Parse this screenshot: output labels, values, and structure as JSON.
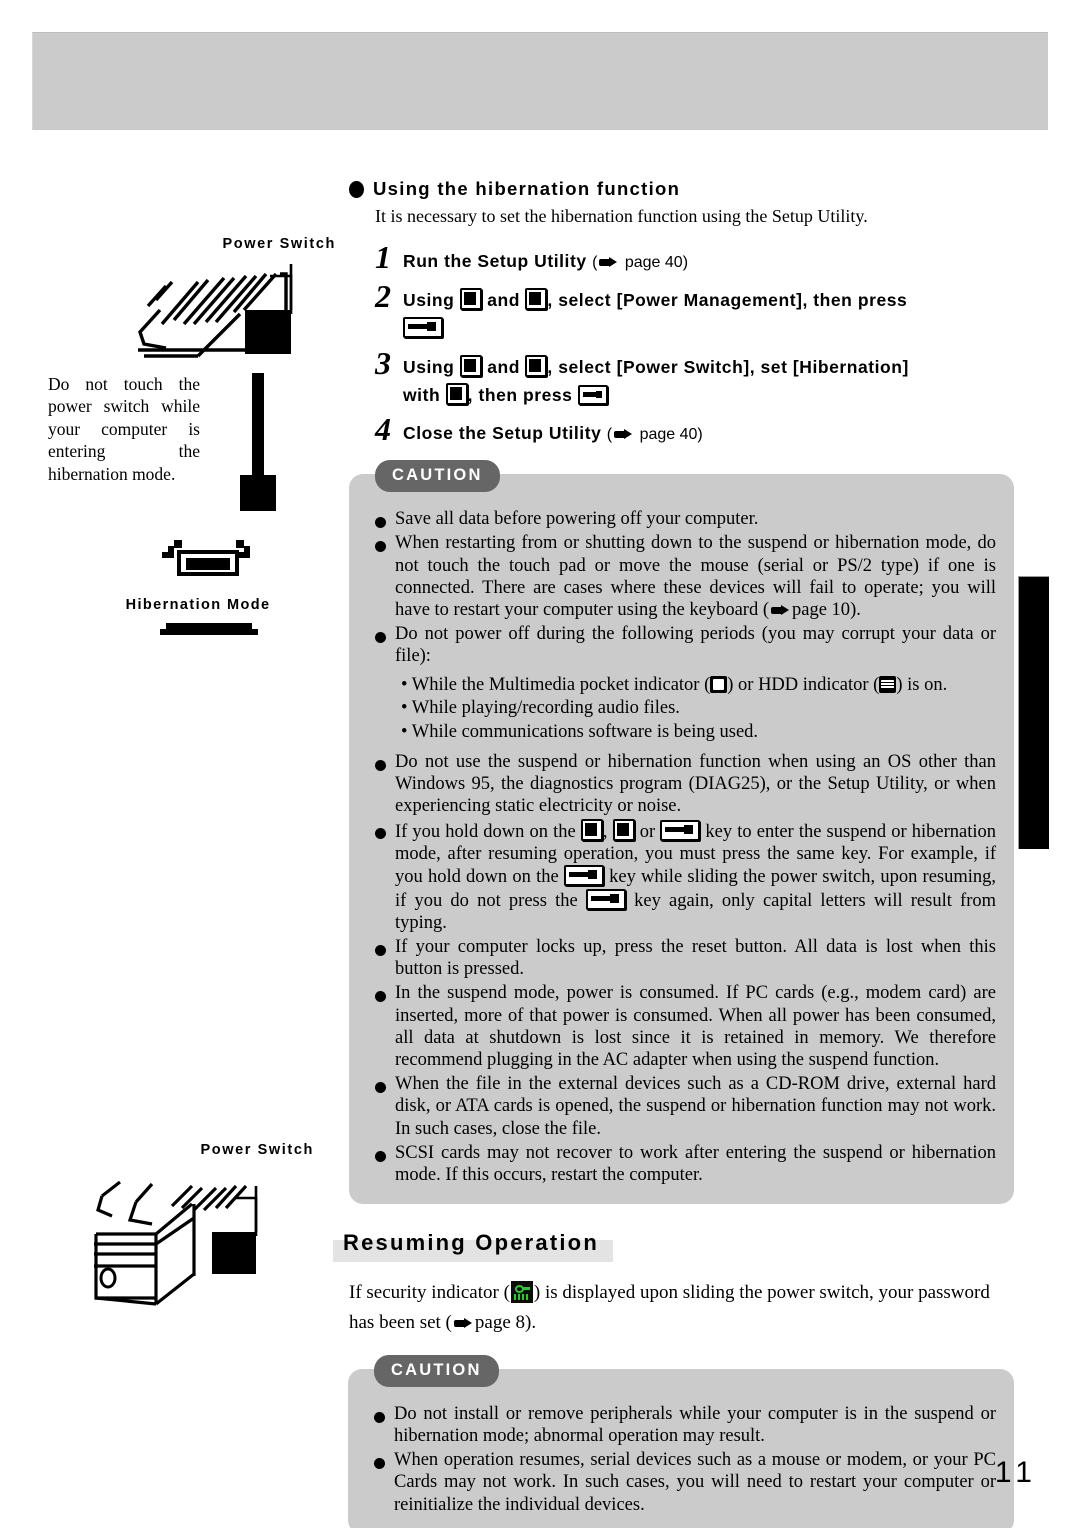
{
  "page": {
    "number": "11"
  },
  "left_column": {
    "top_label": "Power Switch",
    "callout": "Do not touch the power switch while your computer is entering the hibernation mode.",
    "hibernation_label": "Hibernation Mode",
    "bottom_label": "Power Switch"
  },
  "section": {
    "heading": "Using the hibernation function",
    "intro": "It is necessary to set the hibernation function using the Setup Utility."
  },
  "steps": [
    {
      "num": "1",
      "text_a": "Run the Setup Utility",
      "ref": "page 40"
    },
    {
      "num": "2",
      "text_a": "Using",
      "text_b": "and",
      "text_c": ", select [Power Management], then press"
    },
    {
      "num": "3",
      "text_a": "Using",
      "text_b": "and",
      "text_c": ", select [Power Switch], set [Hibernation]",
      "text_d": "with",
      "text_e": ", then press"
    },
    {
      "num": "4",
      "text_a": "Close the Setup Utility",
      "ref": "page 40"
    }
  ],
  "caution_top": {
    "label": "CAUTION",
    "items": [
      "Save all data before powering off your computer.",
      "When restarting from or shutting down to the suspend or hibernation mode, do not touch the touch pad or move the mouse (serial or PS/2 type) if one is connected.  There are cases where these devices will fail to operate; you will have to restart your computer using the keyboard (",
      "Do not power off during the following periods (you may corrupt your data or file):",
      "Do not use the suspend or hibernation function when using an OS other than Windows 95, the diagnostics program (DIAG25), or the Setup Utility, or when experiencing static electricity or noise.",
      "If you hold down on the",
      "If your computer locks up, press the reset button.  All data is lost when this button is pressed.",
      "In the suspend mode, power is consumed.  If PC cards (e.g., modem card) are inserted, more of that power is consumed.  When all power has been consumed, all data at shutdown is lost since it is retained in memory.  We therefore recommend plugging in the AC adapter when using the suspend function.",
      "When the file in the external devices such as a CD-ROM drive, external hard disk, or ATA cards  is opened, the suspend or hibernation function may not work.  In such cases, close the file.",
      "SCSI cards may not recover to work after entering the suspend or hibernation mode. If this occurs, restart the computer."
    ],
    "item2_ref": "page 10",
    "item2_tail": ").",
    "sub_items": [
      "• While the Multimedia pocket indicator (",
      ") or HDD indicator (",
      ") is on.",
      "• While playing/recording audio files.",
      "• While communications software is being used."
    ],
    "item5_parts": {
      "a": "If you hold down on the",
      "b": ",",
      "c": "or",
      "d": "key to enter the suspend or hibernation mode, after resuming operation, you must press the same key.  For example, if you hold down on the",
      "e": "key while sliding the power switch, upon resuming, if you do not press the",
      "f": "key again, only capital letters will result from typing."
    }
  },
  "resuming": {
    "heading": "Resuming Operation",
    "body_a": "If security indicator (",
    "body_b": ") is displayed upon sliding the power switch, your password has been set (",
    "body_ref": "page 8",
    "body_c": ")."
  },
  "caution_bottom": {
    "label": "CAUTION",
    "items": [
      "Do not install or remove peripherals while your computer is in the suspend or hibernation mode; abnormal operation may result.",
      "When operation resumes, serial devices such as a mouse or modem, or your PC Cards may not work.  In such cases, you will need to restart your computer or reinitialize the individual devices."
    ]
  },
  "colors": {
    "header_band": "#cbcbcb",
    "caution_bg": "#cbcbcb",
    "caution_badge": "#666666",
    "heading_highlight": "#e3e3e3",
    "security_green": "#1fd21f"
  }
}
